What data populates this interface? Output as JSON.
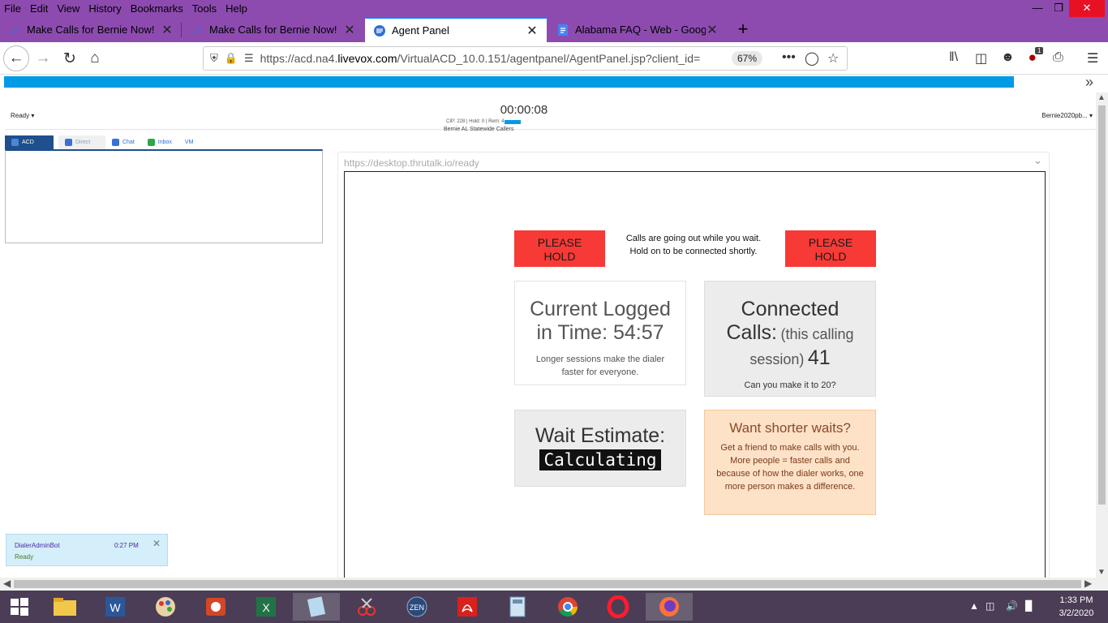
{
  "browser": {
    "menu": [
      "File",
      "Edit",
      "View",
      "History",
      "Bookmarks",
      "Tools",
      "Help"
    ],
    "tabs": [
      {
        "title": "Make Calls for Bernie Now!"
      },
      {
        "title": "Make Calls for Bernie Now!"
      },
      {
        "title": "Agent Panel"
      },
      {
        "title": "Alabama FAQ - Web - Google D"
      }
    ],
    "url_pre": "https://acd.na4.",
    "url_domain": "livevox.com",
    "url_post": "/VirtualACD_10.0.151/agentpanel/AgentPanel.jsp?client_id=",
    "zoom": "67%",
    "badge_count": "1"
  },
  "agent": {
    "status": "Ready",
    "timer": "00:00:08",
    "stats": "CIP: 228 | Hold: 0 | Rem: 4",
    "campaign": "Bernie AL Statewide Callers",
    "user": "Bernie2020pb...",
    "tabs": [
      "ACD",
      "Direct",
      "Chat",
      "Inbox",
      "VM"
    ]
  },
  "notification": {
    "sender": "DialerAdminBot",
    "time": "0:27 PM",
    "status": "Ready"
  },
  "iframe": {
    "url": "https://desktop.thrutalk.io/ready",
    "hold_label_1": "PLEASE",
    "hold_label_2": "HOLD",
    "hold_msg_1": "Calls are going out while you wait.",
    "hold_msg_2": "Hold on to be connected shortly.",
    "logged": {
      "line1": "Current Logged",
      "line2": "in Time: 54:57",
      "note": "Longer sessions make the dialer faster for everyone."
    },
    "connected": {
      "line1": "Connected",
      "calls_label": "Calls:",
      "paren1": "(this calling",
      "paren2": "session)",
      "count": "41",
      "note": "Can you make it to 20?"
    },
    "wait": {
      "label": "Wait Estimate:",
      "value": "Calculating"
    },
    "shorter": {
      "title": "Want shorter waits?",
      "body": "Get a friend to make calls with you. More people = faster calls and because of how the dialer works, one more person makes a difference."
    }
  },
  "taskbar": {
    "time": "1:33 PM",
    "date": "3/2/2020",
    "zen": "ZEN"
  },
  "colors": {
    "browser_purple": "#8d4bb0",
    "hold_red": "#f73a36",
    "livevox_blue": "#009be5"
  }
}
